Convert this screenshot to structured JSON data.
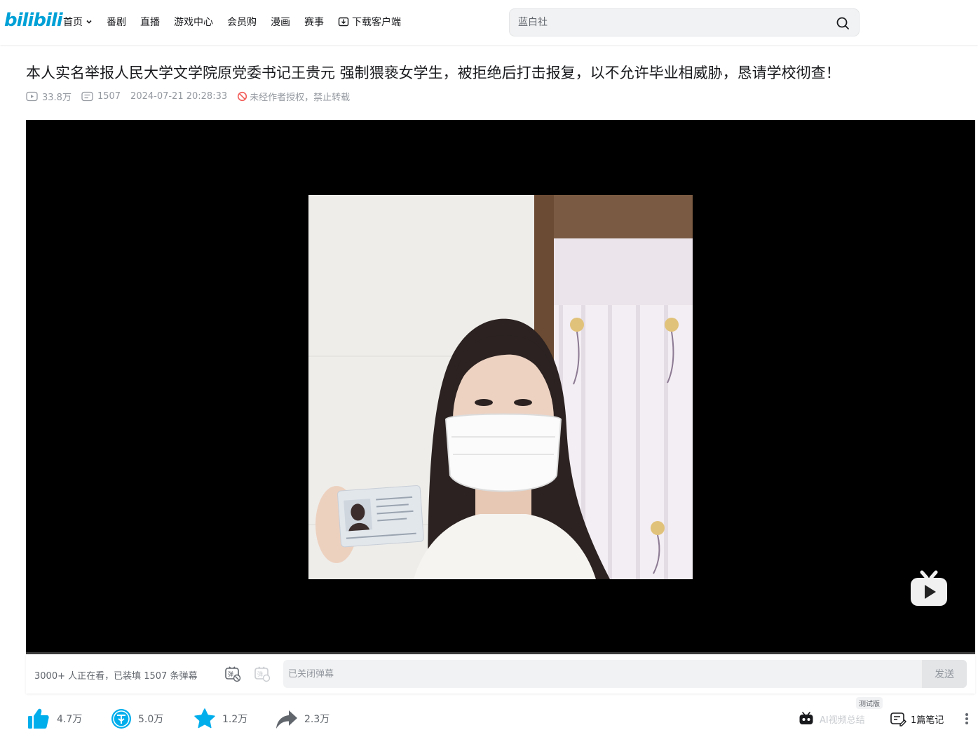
{
  "header": {
    "logo": "bilibili",
    "nav": [
      {
        "label": "首页",
        "has_dropdown": true
      },
      {
        "label": "番剧"
      },
      {
        "label": "直播"
      },
      {
        "label": "游戏中心"
      },
      {
        "label": "会员购"
      },
      {
        "label": "漫画"
      },
      {
        "label": "赛事"
      },
      {
        "label": "下载客户端",
        "icon": "download-icon"
      }
    ],
    "search_placeholder": "蓝白社"
  },
  "video": {
    "title": "本人实名举报人民大学文学院原党委书记王贵元 强制猥亵女学生，被拒绝后打击报复，以不允许毕业相威胁，恳请学校彻查！",
    "views": "33.8万",
    "danmaku_count": "1507",
    "date": "2024-07-21 20:28:33",
    "copyright_notice": "未经作者授权，禁止转载"
  },
  "danmaku_bar": {
    "status": "3000+ 人正在看，已装填 1507 条弹幕",
    "input_placeholder": "已关闭弹幕",
    "send_label": "发送"
  },
  "toolbar": {
    "like": "4.7万",
    "coin": "5.0万",
    "favorite": "1.2万",
    "share": "2.3万",
    "ai_summary": "AI视频总结",
    "ai_badge": "测试版",
    "notes": "1篇笔记"
  },
  "colors": {
    "brand": "#00a1d6",
    "accent": "#00aeec",
    "text_secondary": "#9499a0"
  }
}
